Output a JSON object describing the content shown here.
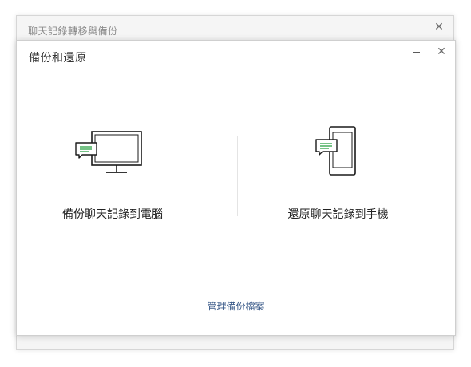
{
  "back_window": {
    "title": "聊天記錄轉移與備份",
    "close_symbol": "✕"
  },
  "dialog": {
    "title": "備份和還原",
    "close_symbol": "✕",
    "options": {
      "backup": {
        "label": "備份聊天記錄到電腦",
        "icon": "desktop-monitor-chat-icon"
      },
      "restore": {
        "label": "還原聊天記錄到手機",
        "icon": "phone-chat-icon"
      }
    },
    "manage_link": "管理備份檔案"
  },
  "colors": {
    "accent_green": "#2ba245",
    "link": "#3b5b8a",
    "icon_stroke": "#1a1a1a"
  }
}
